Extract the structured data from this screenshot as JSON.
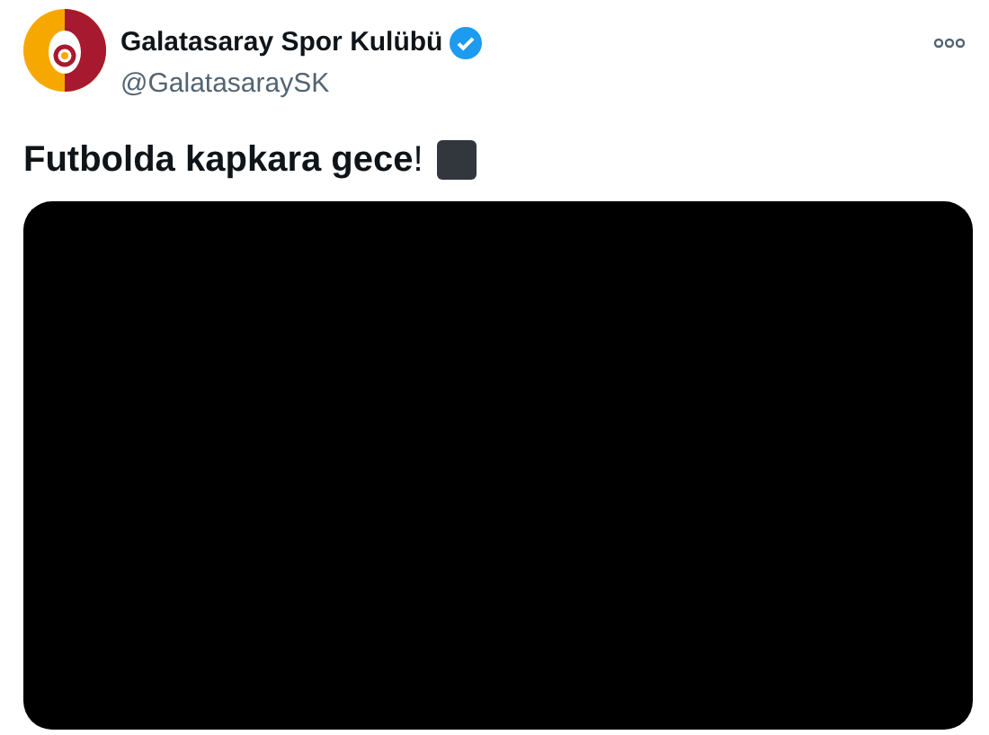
{
  "author": {
    "name": "Galatasaray Spor Kulübü",
    "verified": true,
    "handle": "@GalatasaraySK"
  },
  "tweet": {
    "text": "**Futbolda kapkara gece**!"
  },
  "media": {
    "kind": "video"
  }
}
